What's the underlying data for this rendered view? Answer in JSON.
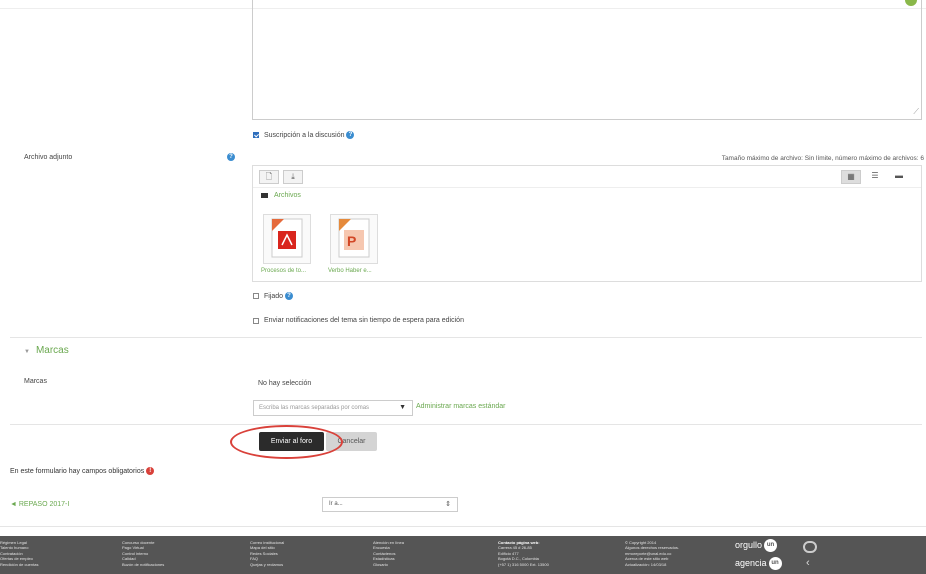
{
  "form": {
    "subscription_label": "Suscripción a la discusión",
    "attachment_label": "Archivo adjunto",
    "max_size_text": "Tamaño máximo de archivo: Sin límite, número máximo de archivos: 6",
    "files_path": "Archivos",
    "files": [
      {
        "name": "Procesos de to...",
        "type": "pdf-file-icon"
      },
      {
        "name": "Verbo Haber e...",
        "type": "powerpoint-file-icon"
      }
    ],
    "pinned_label": "Fijado",
    "notify_label": "Enviar notificaciones del tema sin tiempo de espera para edición"
  },
  "tags": {
    "section_title": "Marcas",
    "field_label": "Marcas",
    "no_selection": "No hay selección",
    "input_placeholder": "Escriba las marcas separadas por comas",
    "manage_link": "Administrar marcas estándar"
  },
  "actions": {
    "submit_label": "Enviar al foro",
    "cancel_label": "Cancelar"
  },
  "required_note": "En este formulario hay campos obligatorios",
  "nav": {
    "prev_link": "◄ REPASO 2017-I",
    "jump_placeholder": "Ir a..."
  },
  "footer": {
    "col1": [
      "Régimen Legal",
      "Talento humano",
      "Contratación",
      "Ofertas de empleo",
      "Rendición de cuentas"
    ],
    "col2": [
      "Concurso docente",
      "Pago Virtual",
      "Control interno",
      "Calidad",
      "Buzón de notificaciones"
    ],
    "col3": [
      "Correo institucional",
      "Mapa del sitio",
      "Redes Sociales",
      "FAQ",
      "Quejas y reclamos"
    ],
    "col4": [
      "Atención en línea",
      "Encuesta",
      "Contáctenos",
      "Estadísticas",
      "Glosario"
    ],
    "col5_title": "Contacto página web:",
    "col5": [
      "Carrera 45 # 26-85",
      "Edificio 477",
      "Bogotá D.C., Colombia",
      "(+57 1) 316 5000 Ext. 13500"
    ],
    "col6": [
      "© Copyright 2014",
      "Algunos derechos reservados.",
      "mmoreporte@unal.edu.co",
      "Acerca de este sitio web",
      "Actualización: 14/03/18"
    ],
    "brand1": "orgullo",
    "brand2": "agencia",
    "brand_mark": "un"
  },
  "colors": {
    "accent_green": "#6aa84f",
    "submit_bg": "#2b2b2b",
    "highlight_ring": "#d9413a",
    "help_blue": "#3b8dd0",
    "footer_bg": "#555555"
  }
}
